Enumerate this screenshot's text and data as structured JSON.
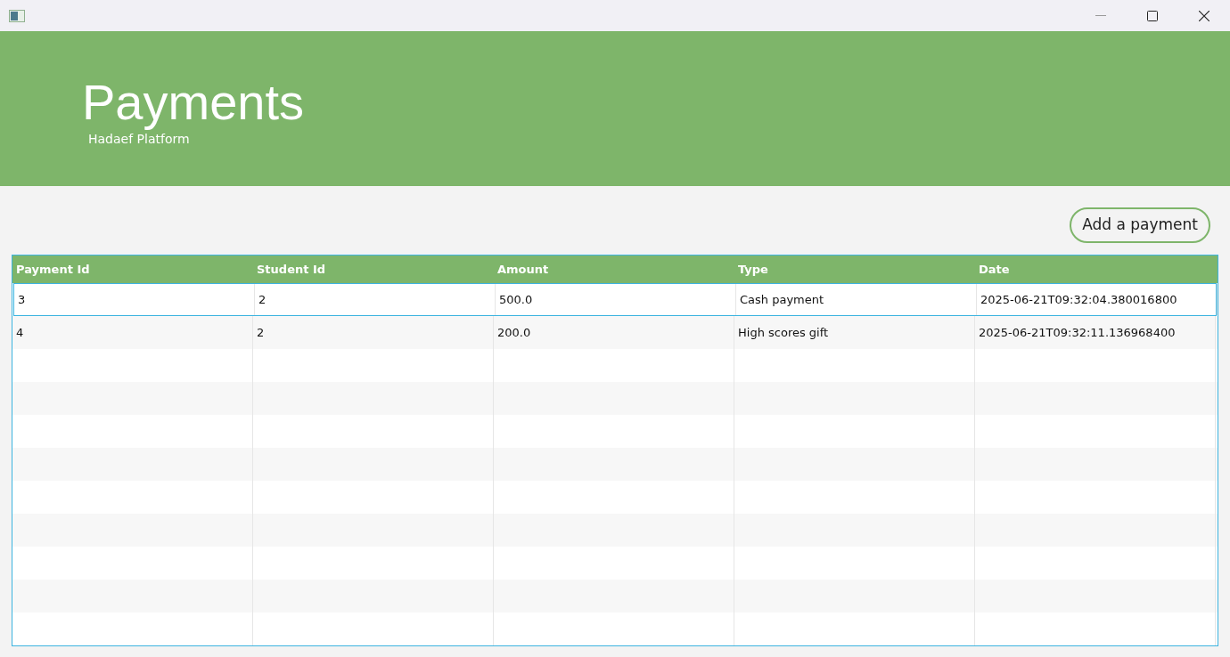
{
  "header": {
    "title": "Payments",
    "subtitle": "Hadaef Platform"
  },
  "add_button": "Add a payment",
  "table": {
    "columns": [
      "Payment Id",
      "Student Id",
      "Amount",
      "Type",
      "Date"
    ],
    "rows": [
      {
        "cells": [
          "3",
          "2",
          "500.0",
          "Cash payment",
          "2025-06-21T09:32:04.380016800"
        ],
        "selected": true
      },
      {
        "cells": [
          "4",
          "2",
          "200.0",
          "High scores gift",
          "2025-06-21T09:32:11.136968400"
        ],
        "selected": false
      }
    ]
  }
}
